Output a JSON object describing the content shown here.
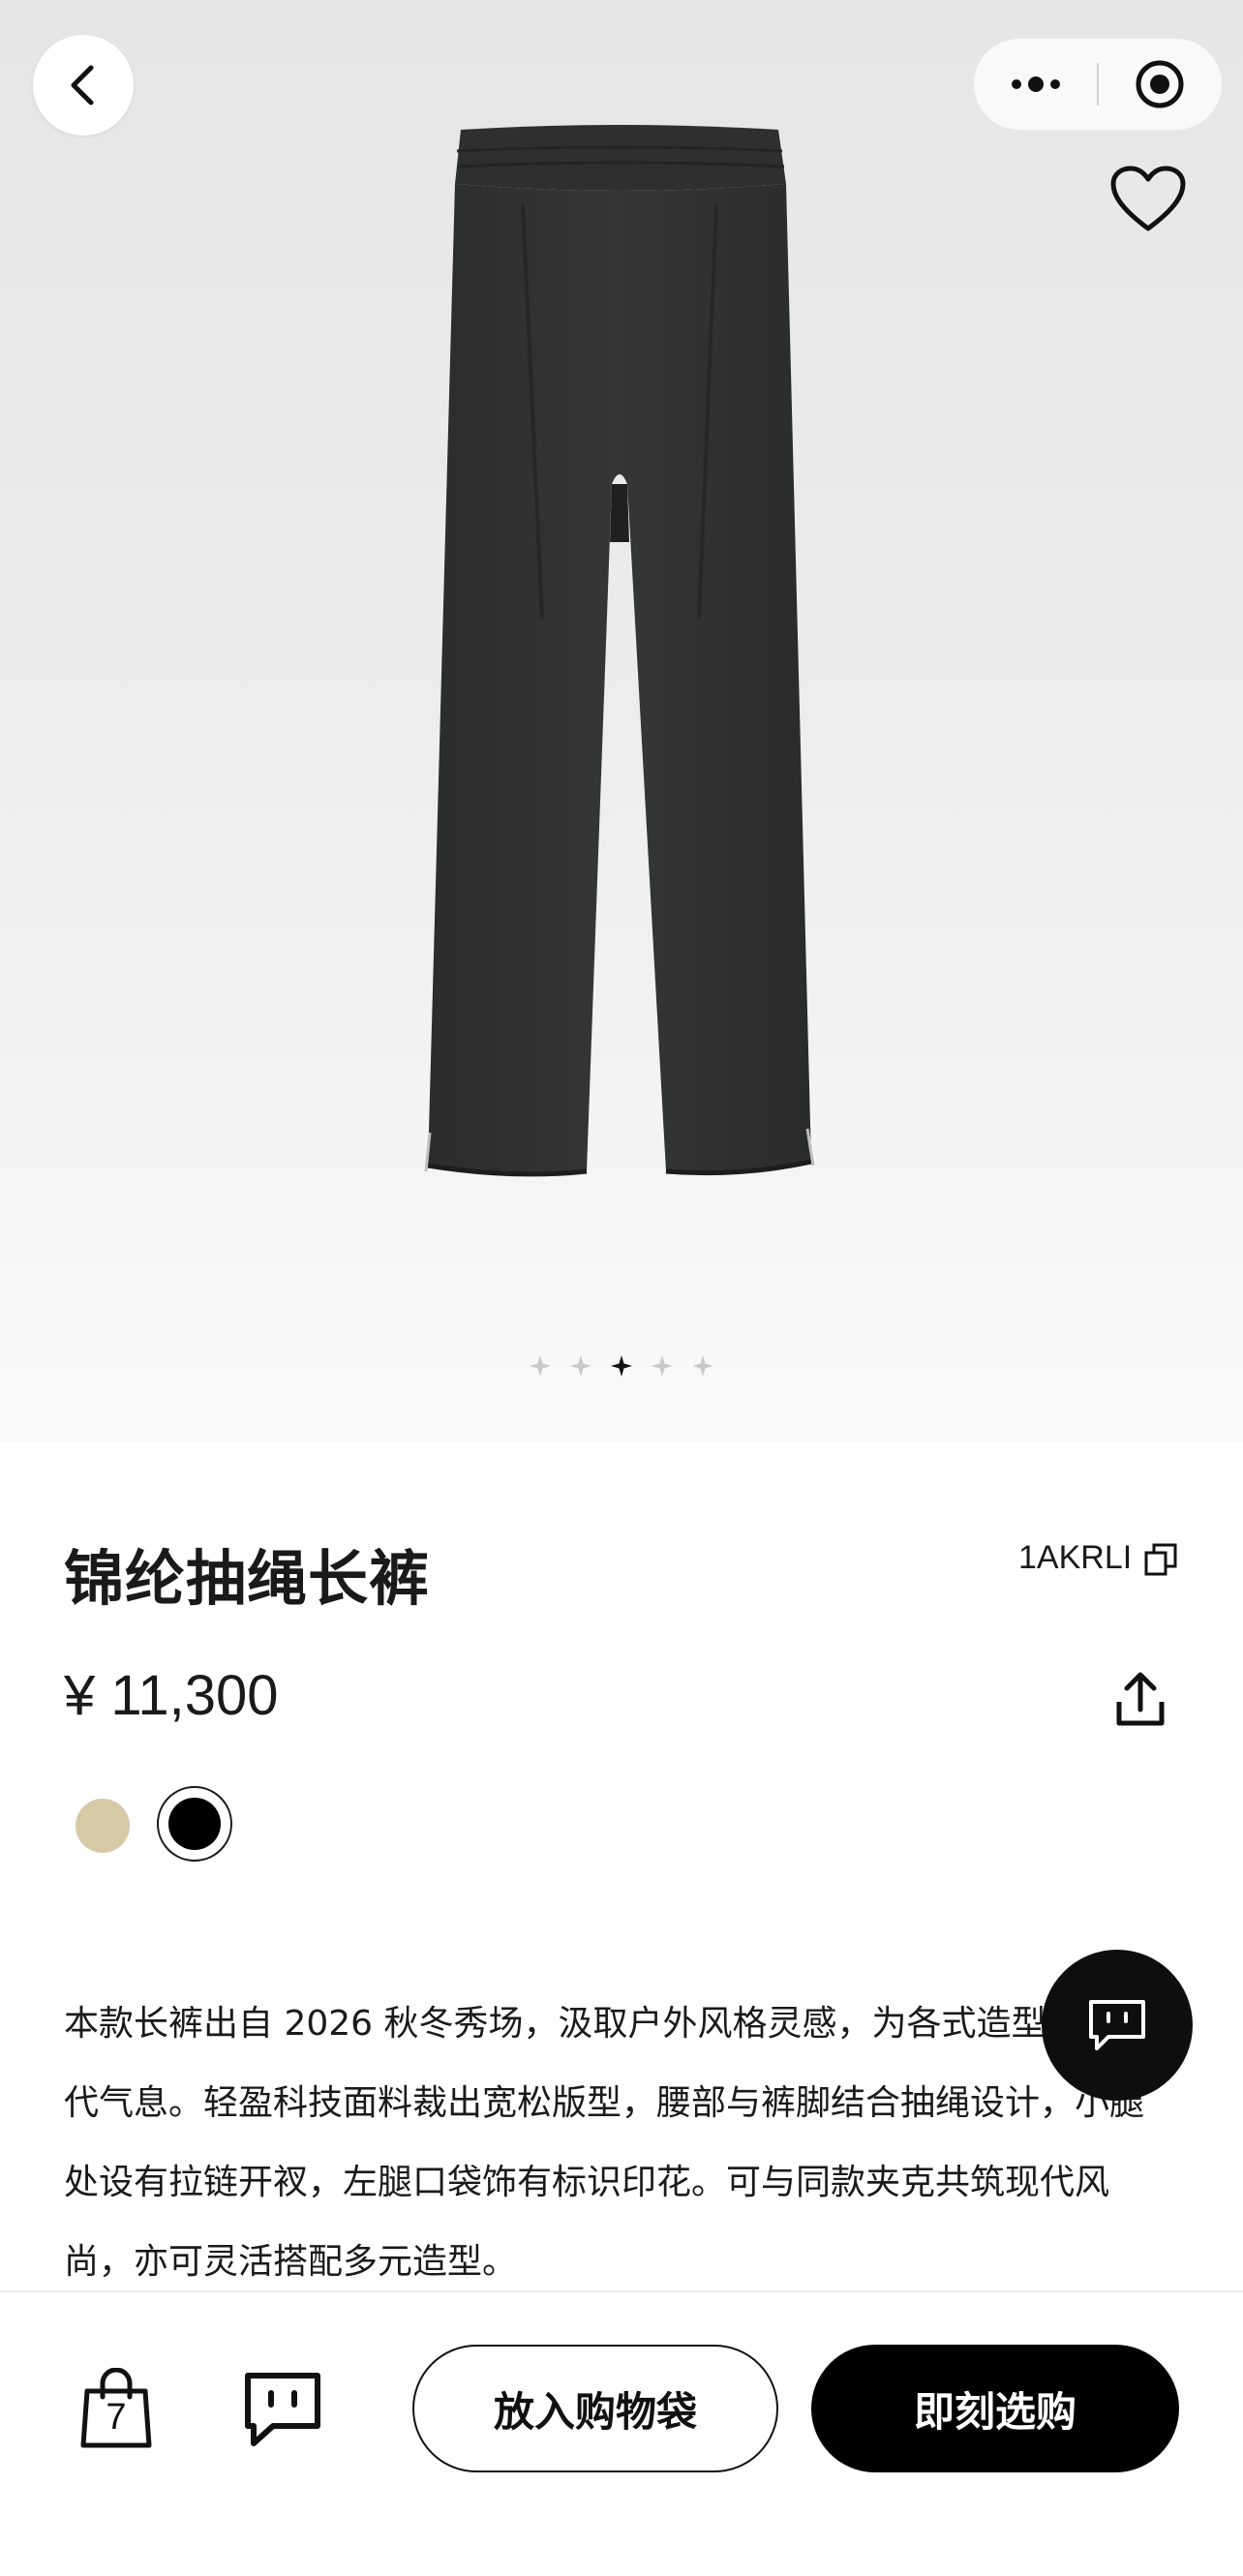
{
  "product": {
    "title": "锦纶抽绳长裤",
    "sku": "1AKRLI",
    "price": "¥ 11,300",
    "description": "本款长裤出自 2026 秋冬秀场，汲取户外风格灵感，为各式造型注入当代气息。轻盈科技面料裁出宽松版型，腰部与裤脚结合抽绳设计，小腿处设有拉链开衩，左腿口袋饰有标识印花。可与同款夹克共筑现代风尚，亦可灵活搭配多元造型。"
  },
  "gallery": {
    "image_count": 5,
    "active_index": 2
  },
  "swatches": [
    {
      "name": "beige",
      "color": "#d6c9a6",
      "selected": false
    },
    {
      "name": "black",
      "color": "#000000",
      "selected": true
    }
  ],
  "bottom_bar": {
    "bag_count": "7",
    "add_to_bag_label": "放入购物袋",
    "buy_now_label": "即刻选购"
  },
  "icons": [
    "back-icon",
    "more-icon",
    "target-icon",
    "heart-icon",
    "copy-icon",
    "share-icon",
    "chat-icon",
    "shopping-bag-icon",
    "message-icon"
  ]
}
